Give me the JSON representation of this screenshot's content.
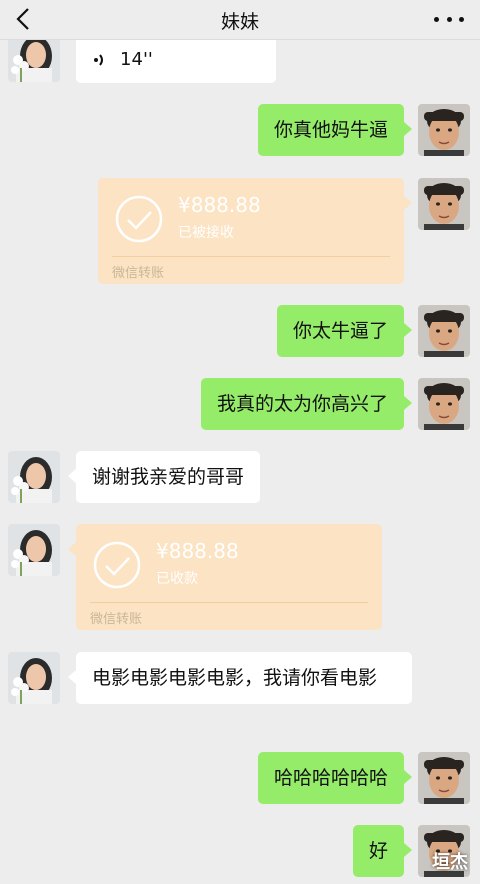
{
  "header": {
    "title": "妹妹"
  },
  "messages": {
    "voice_duration": "14''",
    "m1": "你真他妈牛逼",
    "transfer1": {
      "amount": "¥888.88",
      "status": "已被接收",
      "footer": "微信转账"
    },
    "m2": "你太牛逼了",
    "m3": "我真的太为你高兴了",
    "m4": "谢谢我亲爱的哥哥",
    "transfer2": {
      "amount": "¥888.88",
      "status": "已收款",
      "footer": "微信转账"
    },
    "m5": "电影电影电影电影，我请你看电影",
    "m6": "哈哈哈哈哈哈",
    "m7": "好"
  },
  "watermark": "垣杰",
  "colors": {
    "background": "#ededed",
    "bubble_green": "#95ec69",
    "transfer_bg": "#fbe3c3"
  }
}
